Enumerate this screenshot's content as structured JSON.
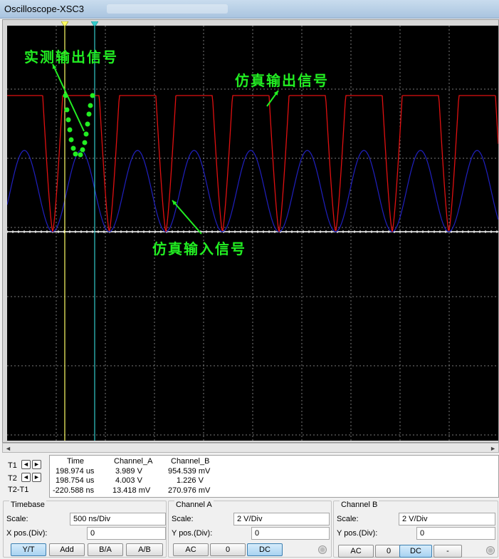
{
  "window": {
    "title": "Oscilloscope-XSC3"
  },
  "annotations": {
    "measured_output": "实测输出信号",
    "sim_output": "仿真输出信号",
    "sim_input": "仿真输入信号"
  },
  "colors": {
    "screen": "#000000",
    "channel_a": "#e01010",
    "channel_b": "#2020c0",
    "cursor_t1": "#ffff66",
    "cursor_t2": "#33cccc",
    "annotation": "#22ee22"
  },
  "readout": {
    "headers": [
      "Time",
      "Channel_A",
      "Channel_B"
    ],
    "rows": [
      {
        "label": "T1",
        "time": "198.974 us",
        "a": "3.989 V",
        "b": "954.539 mV"
      },
      {
        "label": "T2",
        "time": "198.754 us",
        "a": "4.003 V",
        "b": "1.226 V"
      },
      {
        "label": "T2-T1",
        "time": "-220.588 ns",
        "a": "13.418 mV",
        "b": "270.976 mV"
      }
    ]
  },
  "timebase": {
    "title": "Timebase",
    "scale_label": "Scale:",
    "scale_value": "500 ns/Div",
    "xpos_label": "X pos.(Div):",
    "xpos_value": "0",
    "buttons": [
      "Y/T",
      "Add",
      "B/A",
      "A/B"
    ],
    "active": "Y/T"
  },
  "channel_a": {
    "title": "Channel A",
    "scale_label": "Scale:",
    "scale_value": "2  V/Div",
    "ypos_label": "Y pos.(Div):",
    "ypos_value": "0",
    "buttons": [
      "AC",
      "0",
      "DC"
    ],
    "active": "DC"
  },
  "channel_b": {
    "title": "Channel B",
    "scale_label": "Scale:",
    "scale_value": "2  V/Div",
    "ypos_label": "Y pos.(Div):",
    "ypos_value": "0",
    "buttons": [
      "AC",
      "0",
      "DC",
      "-"
    ],
    "active": "DC"
  }
}
